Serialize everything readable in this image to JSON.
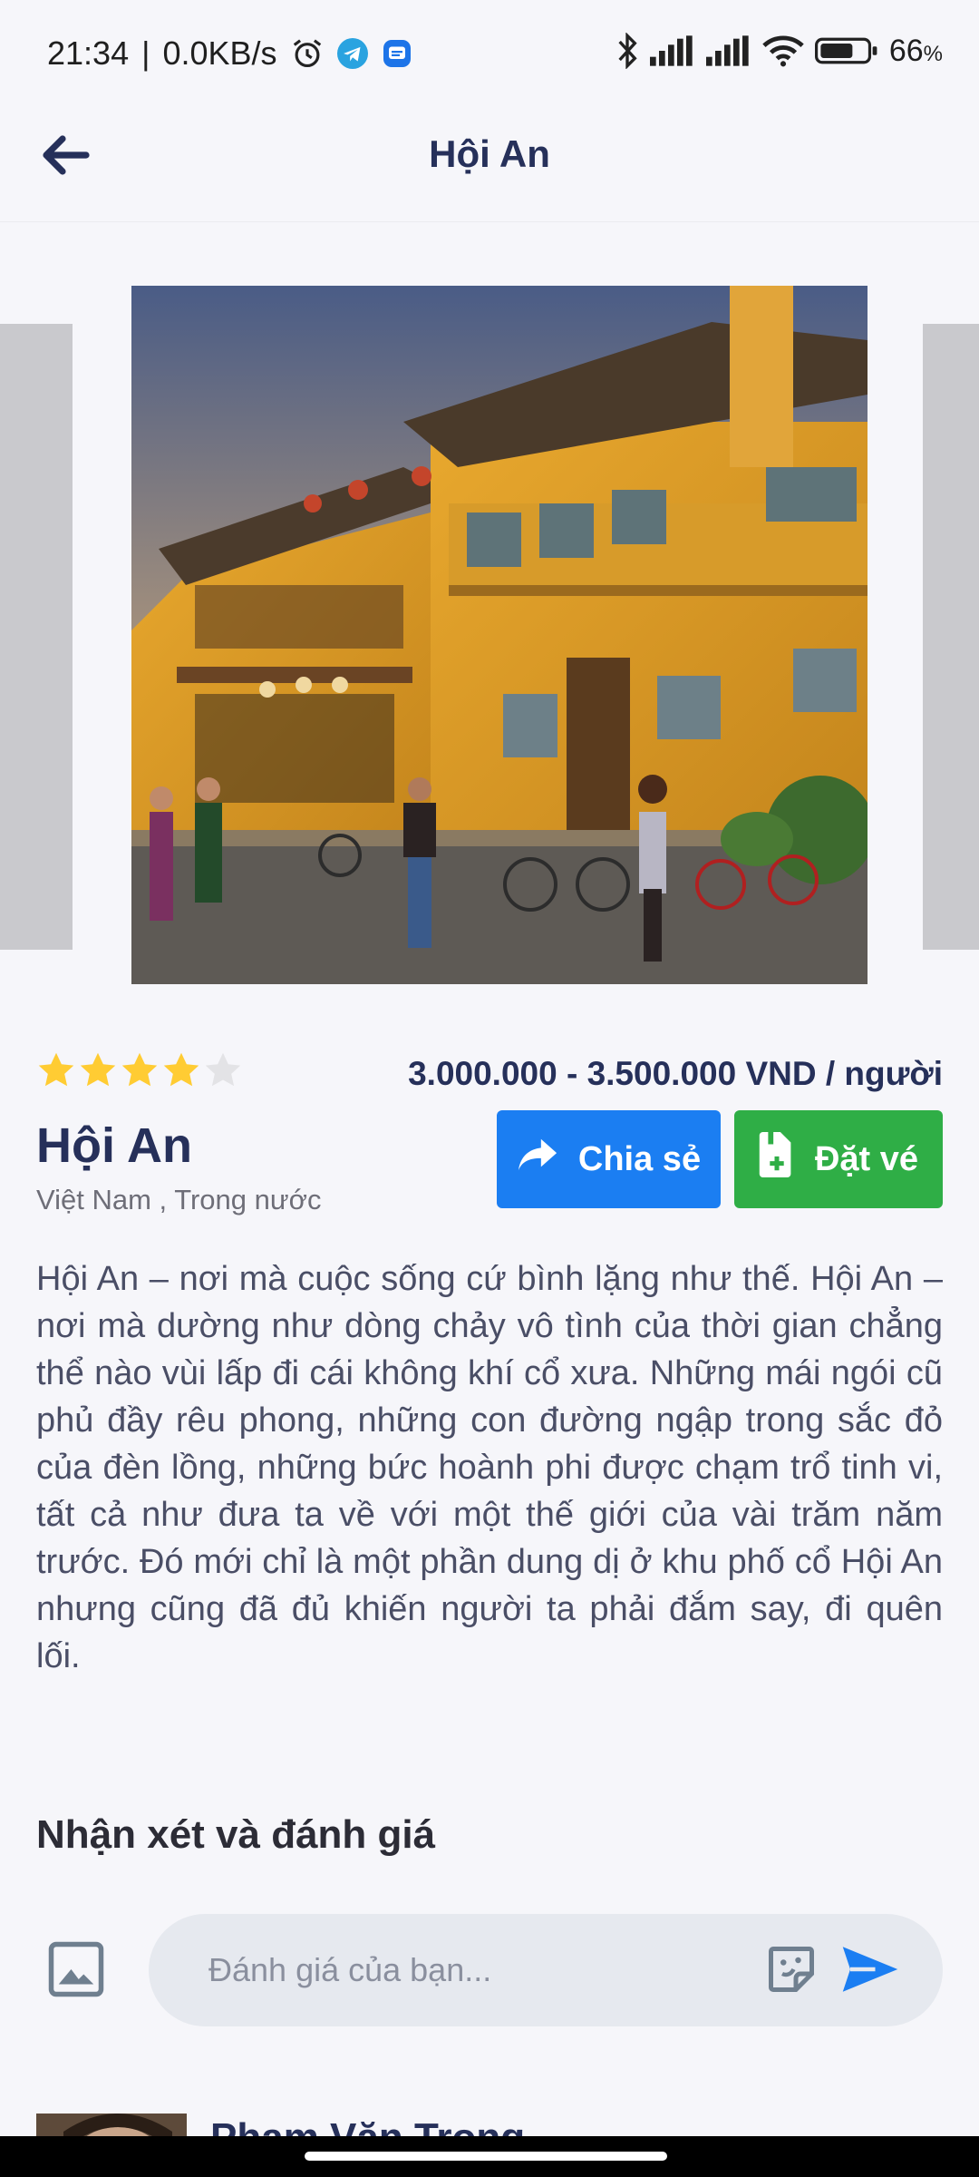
{
  "status_bar": {
    "time": "21:34",
    "network_speed": "0.0KB/s",
    "battery": "66",
    "battery_unit": "%",
    "icons": [
      "alarm-icon",
      "telegram-icon",
      "messages-icon",
      "bluetooth-icon",
      "signal-icon",
      "signal-icon",
      "wifi-icon",
      "battery-icon"
    ]
  },
  "app_bar": {
    "title": "Hội An",
    "back_icon": "arrow-left-icon"
  },
  "carousel": {
    "image_description_icon": "photo"
  },
  "place": {
    "rating": 4,
    "rating_max": 5,
    "price": "3.000.000 - 3.500.000 VND / người",
    "name": "Hội An",
    "location": "Việt Nam , Trong nước",
    "description": "Hội An – nơi mà cuộc sống cứ bình lặng như thế. Hội An – nơi mà dường như dòng chảy vô tình của thời gian chẳng thể nào vùi lấp đi cái không khí cổ xưa. Những mái ngói cũ phủ đầy rêu phong, những con đường ngập trong sắc đỏ của đèn lồng, những bức hoành phi được chạm trổ tinh vi, tất cả như đưa ta về với một thế giới của vài trăm năm trước. Đó mới chỉ là một phần dung dị ở khu phố cổ Hội An nhưng cũng đã đủ khiến người ta phải đắm say, đi quên lối."
  },
  "actions": {
    "share_label": "Chia sẻ",
    "book_label": "Đặt vé",
    "share_color": "#1b7ef2",
    "book_color": "#2fae46"
  },
  "reviews": {
    "title": "Nhận xét và đánh giá",
    "input_placeholder": "Đánh giá của bạn...",
    "first_reviewer_name": "Phạm Văn Trọng"
  },
  "colors": {
    "accent": "#26305a",
    "star": "#ffcc33",
    "star_empty": "#e3e3e6"
  }
}
